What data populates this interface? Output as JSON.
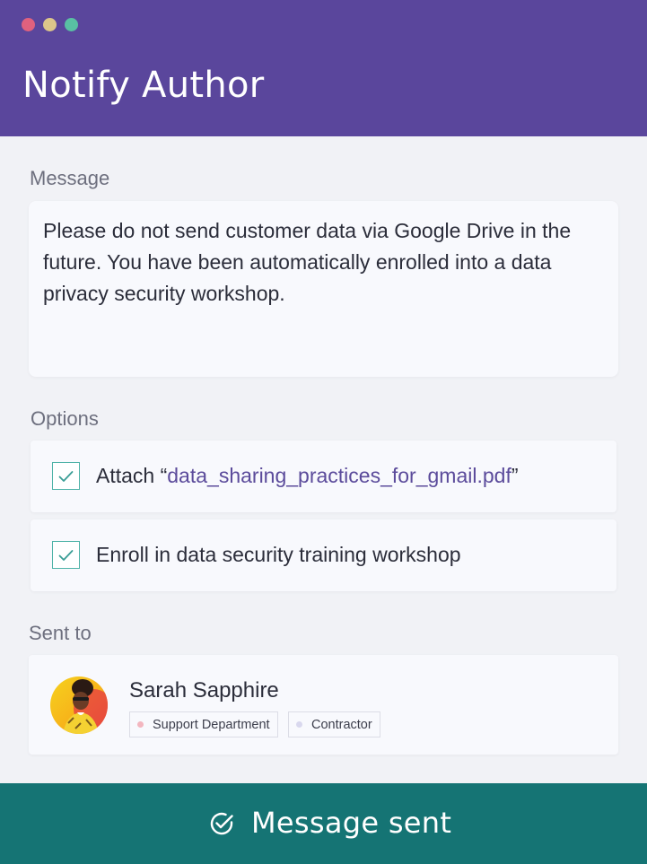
{
  "window": {
    "title": "Notify Author"
  },
  "message": {
    "label": "Message",
    "text": "Please do not send customer data via Google Drive in the future. You have been automatically enrolled into a data privacy security workshop."
  },
  "options": {
    "label": "Options",
    "items": [
      {
        "prefix": "Attach “",
        "filename": "data_sharing_practices_for_gmail.pdf",
        "suffix": "”",
        "checked": true
      },
      {
        "text": "Enroll in data security training workshop",
        "checked": true
      }
    ]
  },
  "sent_to": {
    "label": "Sent to",
    "name": "Sarah Sapphire",
    "tags": [
      {
        "label": "Support Department",
        "dot_color": "#f3b6bf"
      },
      {
        "label": "Contractor",
        "dot_color": "#d9d8ee"
      }
    ]
  },
  "footer": {
    "status": "Message sent",
    "icon": "check-circle-icon"
  },
  "colors": {
    "header": "#5a469c",
    "footer": "#157474",
    "accent_link": "#5b4b9b",
    "checkbox_border": "#4fb3a8"
  }
}
